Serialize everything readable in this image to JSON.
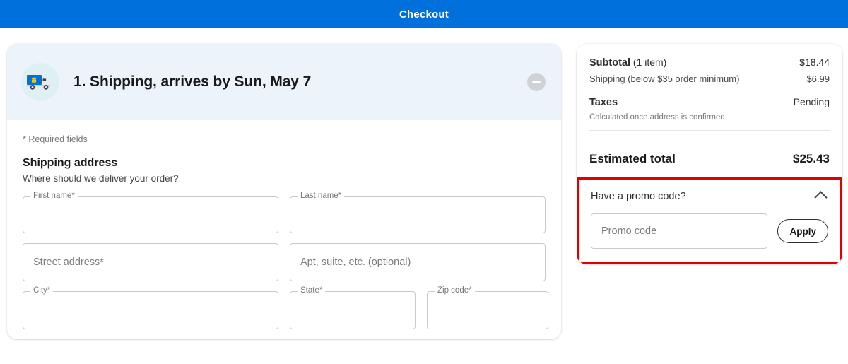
{
  "topbar": {
    "title": "Checkout"
  },
  "shipping": {
    "icon": "delivery-truck-icon",
    "step_title": "1. Shipping, arrives by Sun, May 7",
    "collapse_icon": "minus-icon",
    "required_note": "* Required fields",
    "address_heading": "Shipping address",
    "address_sub": "Where should we deliver your order?",
    "fields": {
      "first_name": {
        "label": "First name*",
        "value": "",
        "style": "float-label"
      },
      "last_name": {
        "label": "Last name*",
        "value": "",
        "style": "float-label"
      },
      "street": {
        "placeholder": "Street address*",
        "value": "",
        "style": "placeholder"
      },
      "apt": {
        "placeholder": "Apt, suite, etc. (optional)",
        "value": "",
        "style": "placeholder"
      },
      "city": {
        "label": "City*",
        "value": "",
        "style": "float-label"
      },
      "state": {
        "label": "State*",
        "value": "",
        "style": "float-label-select",
        "caret_icon": "chevron-down-icon"
      },
      "zip": {
        "label": "Zip code*",
        "value": "",
        "style": "float-label"
      }
    }
  },
  "summary": {
    "subtotal_label_strong": "Subtotal",
    "subtotal_label_light": " (1 item)",
    "subtotal_value": "$18.44",
    "shipping_label": "Shipping (below $35 order minimum)",
    "shipping_value": "$6.99",
    "taxes_label": "Taxes",
    "taxes_value": "Pending",
    "taxes_note": "Calculated once address is confirmed",
    "total_label": "Estimated total",
    "total_value": "$25.43"
  },
  "promo": {
    "heading": "Have a promo code?",
    "toggle_icon": "chevron-up-icon",
    "input_placeholder": "Promo code",
    "input_value": "",
    "apply_label": "Apply",
    "highlight_color": "#e00000"
  },
  "colors": {
    "brand_blue": "#0071dc",
    "header_band": "#edf3fb",
    "annotation_red": "#e00000"
  }
}
